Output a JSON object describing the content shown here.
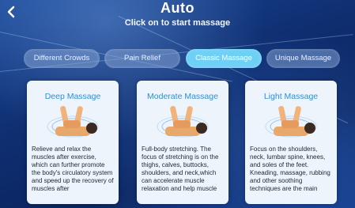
{
  "header": {
    "back_icon": "chevron-left-icon",
    "title": "Auto",
    "subtitle": "Click on to start massage"
  },
  "tabs": [
    {
      "label": "Different Crowds",
      "active": false
    },
    {
      "label": "Pain Relief",
      "active": false
    },
    {
      "label": "Classic Massage",
      "active": true
    },
    {
      "label": "Unique Massage",
      "active": false
    }
  ],
  "cards": [
    {
      "title": "Deep Massage",
      "icon": "back-massage-illustration",
      "description": "Relieve and relax the muscles after exercise, which can further promote the body's circulatory system and speed up the recovery of muscles after"
    },
    {
      "title": "Moderate Massage",
      "icon": "back-massage-illustration",
      "description": "Full-body stretching. The focus of stretching is on the thighs, calves, buttocks, shoulders, and neck,which can accelerate muscle relaxation and help muscle"
    },
    {
      "title": "Light Massage",
      "icon": "back-massage-illustration",
      "description": "Focus on the shoulders, neck, lumbar spine, knees, and soles of the feet. Kneading, massage, rubbing and other soothing techniques are the main"
    }
  ],
  "colors": {
    "accent": "#6fd0f5",
    "card_title": "#2f8fd6",
    "background": "#0f2f72"
  }
}
